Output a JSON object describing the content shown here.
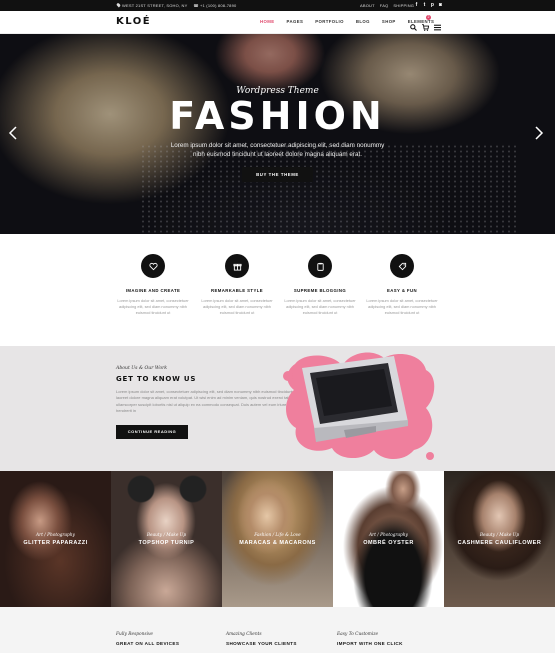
{
  "topbar": {
    "address": "WEST 21ST STREET, SOHO, NY",
    "phone": "+1 (100) 808-7890",
    "links": [
      "ABOUT",
      "FAQ",
      "SHIPPING"
    ],
    "socials": [
      "facebook-icon",
      "twitter-icon",
      "pinterest-icon",
      "instagram-icon"
    ]
  },
  "nav": {
    "logo": "KLOÉ",
    "menu": [
      "HOME",
      "PAGES",
      "PORTFOLIO",
      "BLOG",
      "SHOP",
      "ELEMENTS"
    ],
    "active": "HOME",
    "cart_count": "2",
    "accent": "#e0466a"
  },
  "hero": {
    "subtitle": "Wordpress Theme",
    "title": "FASHION",
    "text": "Lorem ipsum dolor sit amet, consectetuer adipiscing elit, sed diam nonummy nibh euismod tincidunt ut laoreet dolore magna aliquam erat.",
    "button": "BUY THE THEME"
  },
  "features": [
    {
      "icon": "heart-icon",
      "title": "IMAGINE AND CREATE",
      "text": "Lorem ipsum dolor sit amet, consectetuer adipiscing elit, sed diam nonummy nibh euismod tincidunt ut"
    },
    {
      "icon": "gift-icon",
      "title": "REMARKABLE STYLE",
      "text": "Lorem ipsum dolor sit amet, consectetuer adipiscing elit, sed diam nonummy nibh euismod tincidunt ut"
    },
    {
      "icon": "clipboard-icon",
      "title": "SUPREME BLOGGING",
      "text": "Lorem ipsum dolor sit amet, consectetuer adipiscing elit, sed diam nonummy nibh euismod tincidunt ut"
    },
    {
      "icon": "tag-icon",
      "title": "EASY & FUN",
      "text": "Lorem ipsum dolor sit amet, consectetuer adipiscing elit, sed diam nonummy nibh euismod tincidunt ut"
    }
  ],
  "about": {
    "kicker": "About Us & Our Work",
    "title": "GET TO KNOW US",
    "text": "Lorem ipsum dolor sit amet, consectetuer adipiscing elit, sed diam nonummy nibh euismod tincidunt ut laoreet dolore magna aliquam erat volutpat. Ut wisi enim ad minim veniam, quis nostrud exerci tation ullamcorper suscipit lobortis nisl ut aliquip ex ea commodo consequat. Duis autem vel eum iriure dolor in hendrerit in",
    "button": "CONTINUE READING"
  },
  "gallery": [
    {
      "category": "Art / Photography",
      "name": "GLITTER PAPARAZZI"
    },
    {
      "category": "Beauty / Make Up",
      "name": "TOPSHOP TURNIP"
    },
    {
      "category": "Fashion / Life & Love",
      "name": "MARACAS & MACARONS"
    },
    {
      "category": "Art / Photography",
      "name": "OMBRÉ OYSTER"
    },
    {
      "category": "Beauty / Make Up",
      "name": "CASHMERE CAULIFLOWER"
    }
  ],
  "strip": [
    {
      "kicker": "Fully Responsive",
      "title": "GREAT ON ALL DEVICES"
    },
    {
      "kicker": "Amazing Clients",
      "title": "SHOWCASE YOUR CLIENTS"
    },
    {
      "kicker": "Easy To Customize",
      "title": "IMPORT WITH ONE CLICK"
    }
  ]
}
